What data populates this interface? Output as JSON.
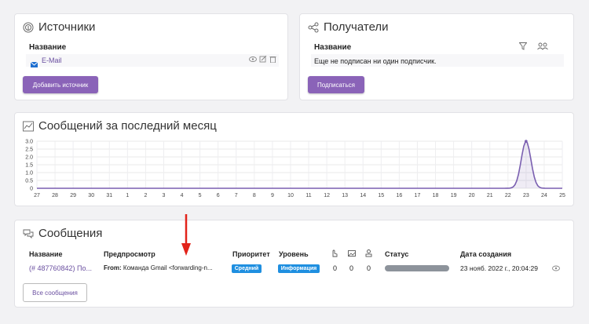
{
  "sources": {
    "title": "Источники",
    "column_name": "Название",
    "item_name": "E-Mail",
    "add_button": "Добавить источник"
  },
  "recipients": {
    "title": "Получатели",
    "column_name": "Название",
    "empty_text": "Еще не подписан ни один подписчик.",
    "subscribe_button": "Подписаться"
  },
  "chart_card": {
    "title": "Сообщений за последний месяц"
  },
  "chart_data": {
    "type": "line",
    "x": [
      "27",
      "28",
      "29",
      "30",
      "31",
      "1",
      "2",
      "3",
      "4",
      "5",
      "6",
      "7",
      "8",
      "9",
      "10",
      "11",
      "12",
      "13",
      "14",
      "15",
      "16",
      "17",
      "18",
      "19",
      "20",
      "21",
      "22",
      "23",
      "24",
      "25"
    ],
    "series": [
      {
        "values": [
          0,
          0,
          0,
          0,
          0,
          0,
          0,
          0,
          0,
          0,
          0,
          0,
          0,
          0,
          0,
          0,
          0,
          0,
          0,
          0,
          0,
          0,
          0,
          0,
          0,
          0,
          0,
          3,
          0,
          0
        ]
      }
    ],
    "yticks": [
      "3.0",
      "2.5",
      "2.0",
      "1.5",
      "1.0",
      "0.5",
      "0"
    ],
    "ylim": [
      0,
      3
    ],
    "grid": true,
    "color": "#7a5fb0"
  },
  "messages": {
    "title": "Сообщения",
    "headers": {
      "name": "Название",
      "preview": "Предпросмотр",
      "priority": "Приоритет",
      "level": "Уровень",
      "status": "Статус",
      "created": "Дата создания"
    },
    "row": {
      "name": "(# 487760842) По...",
      "preview_label": "From:",
      "preview_text": "Команда Gmail <forwarding-n...",
      "priority": "Средний",
      "level": "Информация",
      "count1": "0",
      "count2": "0",
      "count3": "0",
      "created": "23 нояб. 2022 г., 20:04:29"
    },
    "all_button": "Все сообщения"
  },
  "colors": {
    "accent": "#8a63b8",
    "badge": "#1f8fe0",
    "arrow": "#e2231a"
  }
}
